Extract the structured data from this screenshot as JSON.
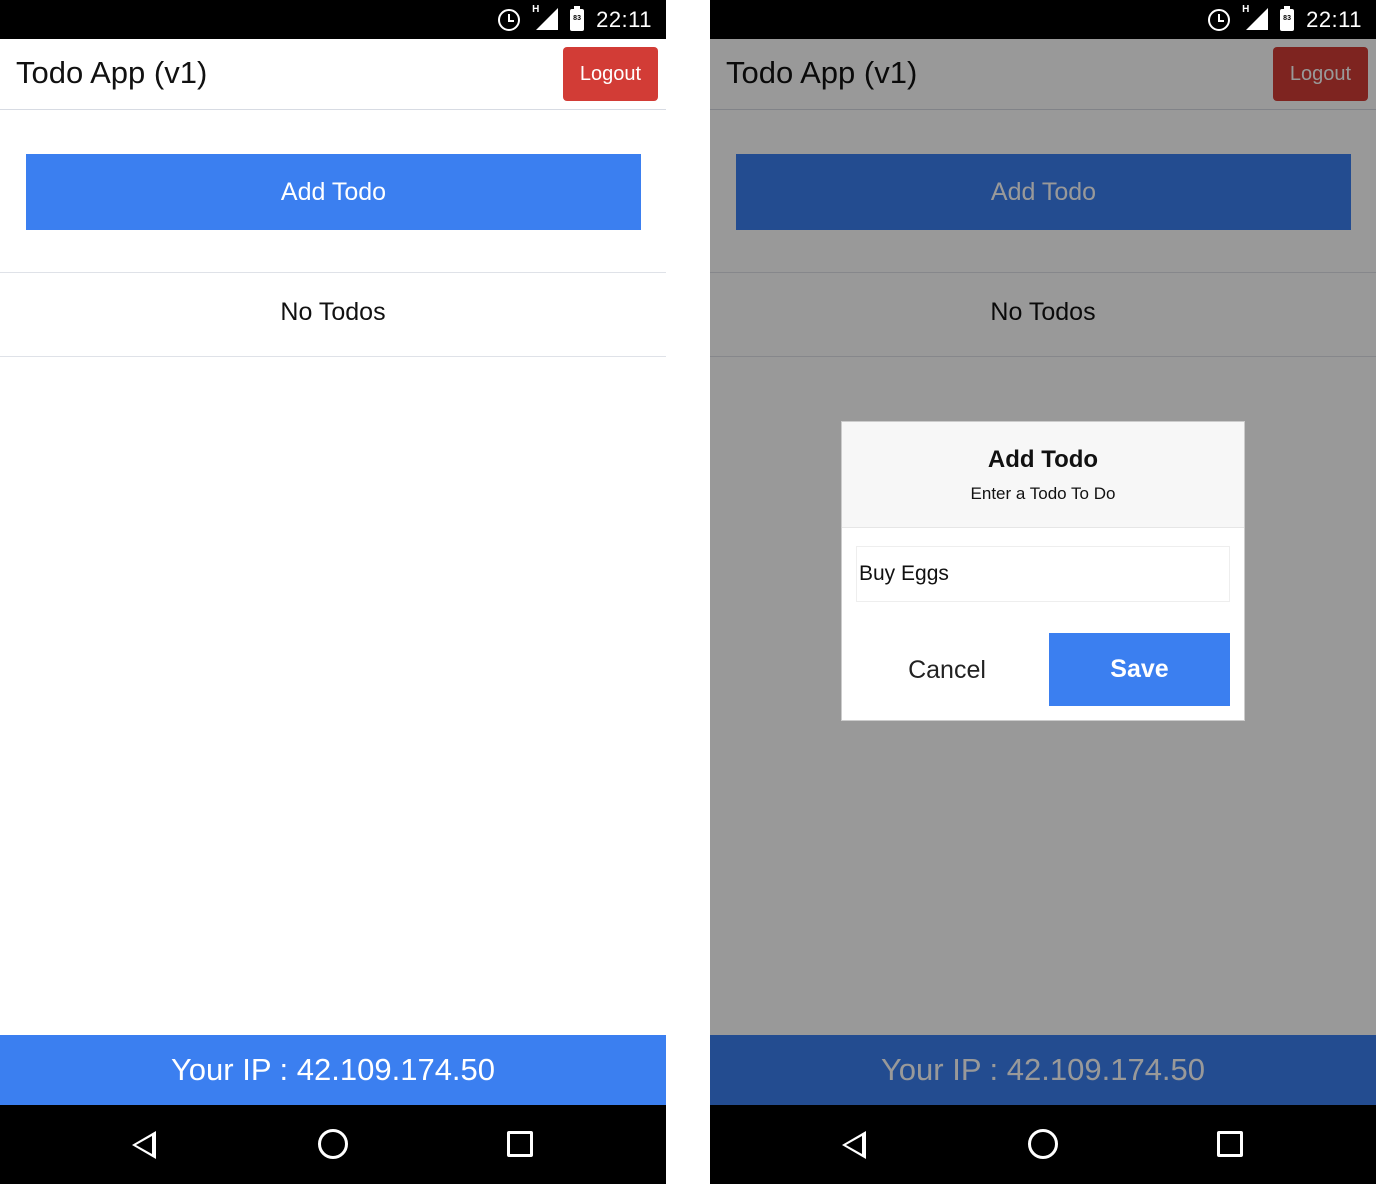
{
  "status_bar": {
    "time": "22:11",
    "battery_level": "83",
    "network_type": "H",
    "icons": [
      "alarm-icon",
      "signal-icon",
      "battery-icon"
    ]
  },
  "app": {
    "title": "Todo App (v1)",
    "logout_label": "Logout",
    "add_todo_label": "Add Todo",
    "empty_message": "No Todos",
    "footer_text": "Your IP : 42.109.174.50"
  },
  "dialog": {
    "title": "Add Todo",
    "message": "Enter a Todo To Do",
    "input_value": "Buy Eggs",
    "cancel_label": "Cancel",
    "save_label": "Save"
  },
  "nav_bar": {
    "icons": [
      "back-icon",
      "home-icon",
      "recents-icon"
    ]
  },
  "colors": {
    "primary": "#3b7ff0",
    "danger": "#d23c36",
    "overlay": "rgba(0,0,0,0.40)"
  }
}
